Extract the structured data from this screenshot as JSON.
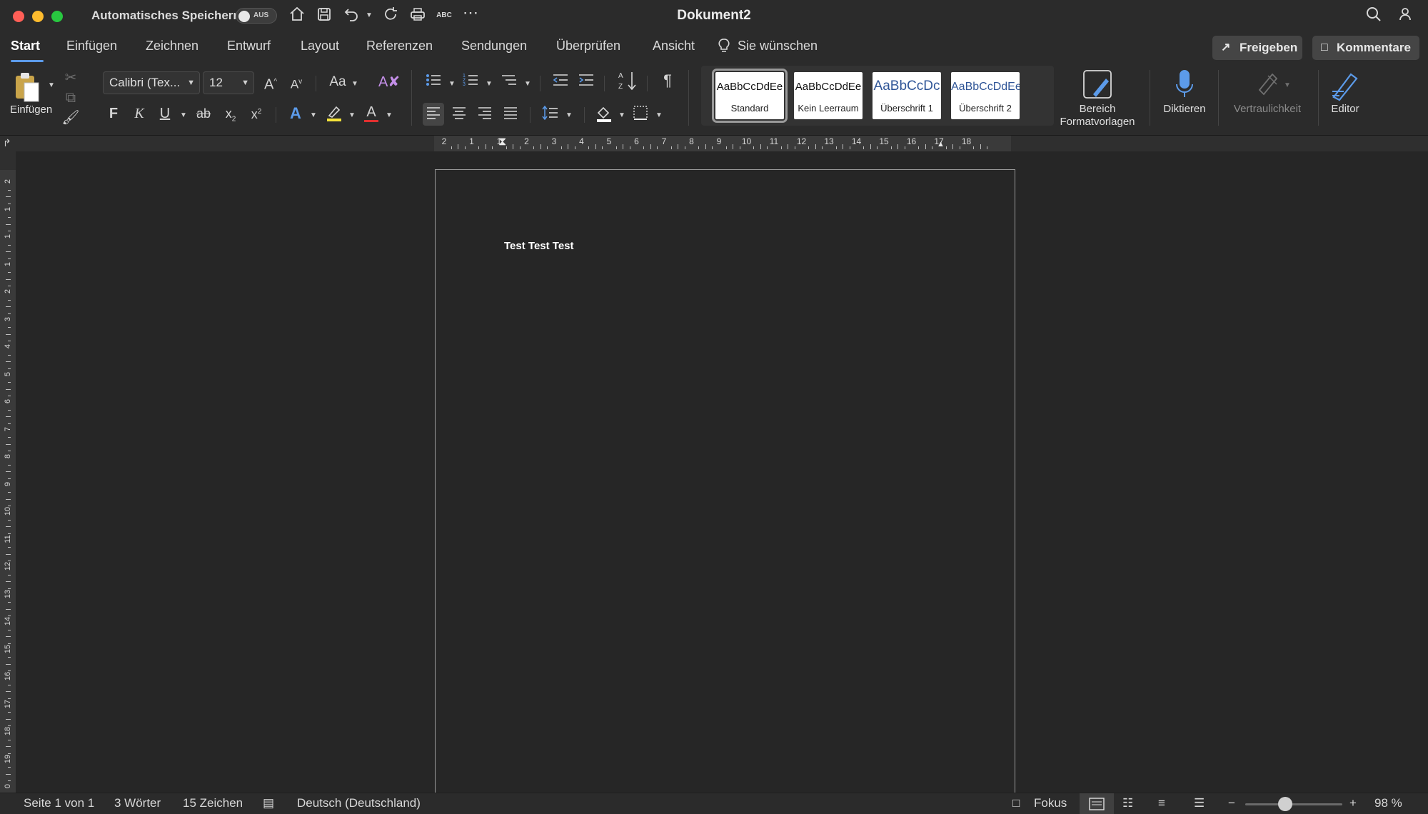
{
  "titlebar": {
    "autosave_label": "Automatisches Speichern",
    "autosave_state": "AUS",
    "document_title": "Dokument2",
    "icons": [
      "home-icon",
      "save-icon",
      "undo-icon",
      "redo-icon",
      "print-icon",
      "spellcheck-icon",
      "more-icon",
      "search-icon",
      "account-icon"
    ]
  },
  "tabs": [
    {
      "label": "Start",
      "active": true
    },
    {
      "label": "Einfügen"
    },
    {
      "label": "Zeichnen"
    },
    {
      "label": "Entwurf"
    },
    {
      "label": "Layout"
    },
    {
      "label": "Referenzen"
    },
    {
      "label": "Sendungen"
    },
    {
      "label": "Überprüfen"
    },
    {
      "label": "Ansicht"
    },
    {
      "label": "Sie wünschen"
    }
  ],
  "share_label": "Freigeben",
  "comments_label": "Kommentare",
  "ribbon": {
    "paste_label": "Einfügen",
    "font_name": "Calibri (Tex...",
    "font_size": "12",
    "bold": "F",
    "italic": "K",
    "underline": "U",
    "strike": "ab",
    "change_case": "Aa",
    "styles": [
      {
        "sample": "AaBbCcDdEe",
        "name": "Standard",
        "selected": true
      },
      {
        "sample": "AaBbCcDdEe",
        "name": "Kein Leerraum"
      },
      {
        "sample": "AaBbCcDc",
        "name": "Überschrift 1"
      },
      {
        "sample": "AaBbCcDdEe",
        "name": "Überschrift 2"
      }
    ],
    "styles_pane_label_1": "Bereich",
    "styles_pane_label_2": "Formatvorlagen",
    "dictate_label": "Diktieren",
    "sensitivity_label": "Vertraulichkeit",
    "editor_label": "Editor"
  },
  "ruler": {
    "h_numbers": [
      "2",
      "1",
      "1",
      "2",
      "3",
      "4",
      "5",
      "6",
      "7",
      "8",
      "9",
      "10",
      "11",
      "12",
      "13",
      "14",
      "15",
      "16",
      "17",
      "18"
    ],
    "v_numbers": [
      "2",
      "1",
      "1",
      "1",
      "2",
      "3",
      "4",
      "5",
      "6",
      "7",
      "8",
      "9",
      "10",
      "11",
      "12",
      "13",
      "14",
      "15",
      "16",
      "17",
      "18",
      "19",
      "0"
    ]
  },
  "document": {
    "text": "Test Test Test"
  },
  "statusbar": {
    "page": "Seite 1 von 1",
    "words": "3 Wörter",
    "chars": "15 Zeichen",
    "language": "Deutsch (Deutschland)",
    "focus": "Fokus",
    "zoom": "98 %",
    "zoom_level": 0.4
  },
  "colors": {
    "accent": "#5c9bea",
    "background": "#262626",
    "chrome": "#2b2b2b",
    "highlight_yellow": "#f5e23a",
    "text_color_red": "#e03030"
  }
}
